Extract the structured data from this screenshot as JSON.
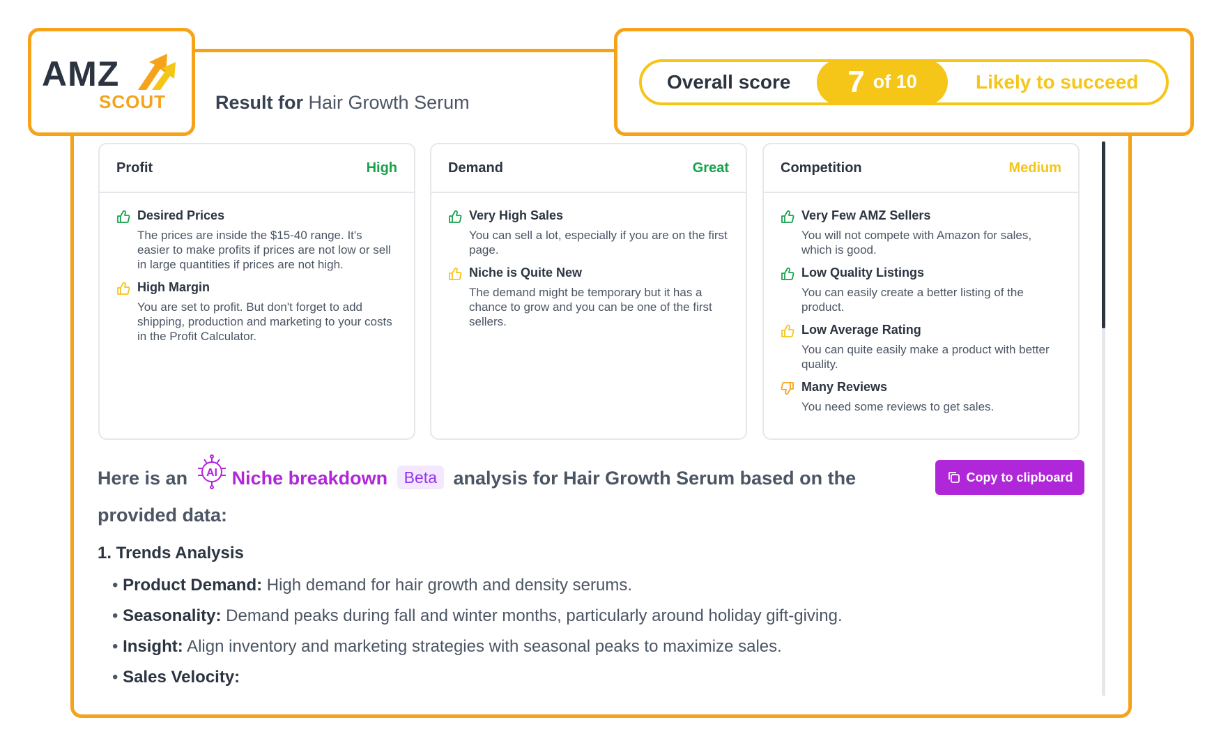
{
  "logo": {
    "word": "AMZ",
    "sub": "SCOUT"
  },
  "score": {
    "label": "Overall score",
    "value": "7",
    "of": "of 10",
    "verdict": "Likely to succeed"
  },
  "result": {
    "prefix": "Result for",
    "name": "Hair Growth Serum"
  },
  "colors": {
    "orange": "#f5a31a",
    "yellow": "#f5c518",
    "green": "#16a34a",
    "purple": "#b026d9"
  },
  "cards": [
    {
      "title": "Profit",
      "rating": "High",
      "rating_color": "#16a34a",
      "items": [
        {
          "icon": "thumbs-up-green-icon",
          "title": "Desired Prices",
          "desc": "The prices are inside the $15-40 range. It's easier to make profits if prices are not low or sell in large quantities if prices are not high."
        },
        {
          "icon": "thumbs-up-yellow-icon",
          "title": "High Margin",
          "desc": "You are set to profit. But don't forget to add shipping, production and marketing to your costs in the Profit Calculator."
        }
      ]
    },
    {
      "title": "Demand",
      "rating": "Great",
      "rating_color": "#16a34a",
      "items": [
        {
          "icon": "thumbs-up-green-icon",
          "title": "Very High Sales",
          "desc": "You can sell a lot, especially if you are on the first page."
        },
        {
          "icon": "thumbs-up-yellow-icon",
          "title": "Niche is Quite New",
          "desc": "The demand might be temporary but it has a chance to grow and you can be one of the first sellers."
        }
      ]
    },
    {
      "title": "Competition",
      "rating": "Medium",
      "rating_color": "#f5c518",
      "items": [
        {
          "icon": "thumbs-up-green-icon",
          "title": "Very Few AMZ Sellers",
          "desc": "You will not compete with Amazon for sales, which is good."
        },
        {
          "icon": "thumbs-up-green-icon",
          "title": "Low Quality Listings",
          "desc": "You can easily create a better listing of the product."
        },
        {
          "icon": "thumbs-up-yellow-icon",
          "title": "Low Average Rating",
          "desc": "You can quite easily make a product with better quality."
        },
        {
          "icon": "thumbs-down-orange-icon",
          "title": "Many Reviews",
          "desc": "You need some reviews to get sales."
        }
      ]
    }
  ],
  "ai": {
    "prefix": "Here is an",
    "icon_text": "AI",
    "niche": "Niche breakdown",
    "beta": "Beta",
    "suffix": "analysis for Hair Growth Serum based on the provided data:"
  },
  "copy_button": "Copy to clipboard",
  "trends": {
    "title": "1. Trends Analysis",
    "bullets": [
      {
        "label": "Product Demand:",
        "text": "High demand for hair growth and density serums."
      },
      {
        "label": "Seasonality:",
        "text": "Demand peaks during fall and winter months, particularly around holiday gift-giving."
      },
      {
        "label": "Insight:",
        "text": "Align inventory and marketing strategies with seasonal peaks to maximize sales."
      },
      {
        "label": "Sales Velocity:",
        "text": ""
      }
    ]
  }
}
